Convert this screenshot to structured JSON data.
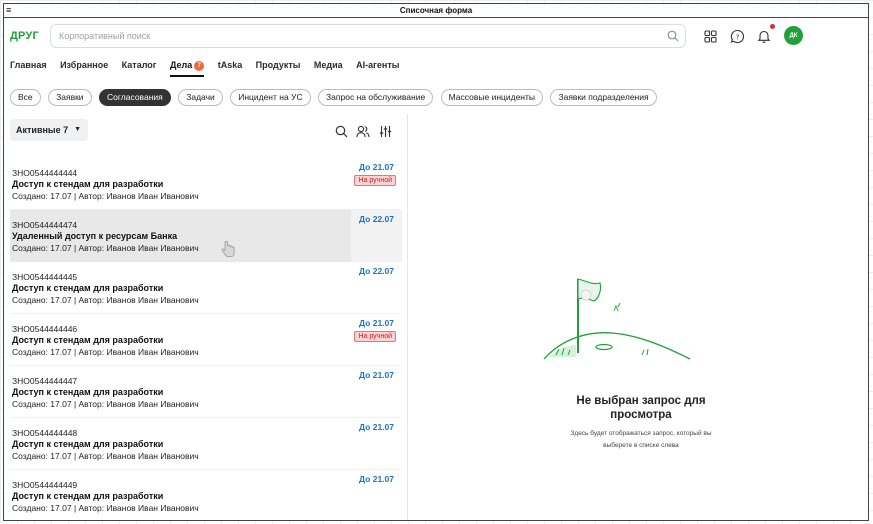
{
  "window": {
    "title": "Списочная форма",
    "menu_glyph": "≡"
  },
  "header": {
    "logo": "ДРУГ",
    "search_placeholder": "Корпоративный поиск",
    "avatar_initials": "ДК",
    "icons": [
      "grid-icon",
      "chat-help-icon",
      "bell-icon"
    ]
  },
  "nav": {
    "items": [
      {
        "label": "Главная"
      },
      {
        "label": "Избранное"
      },
      {
        "label": "Каталог"
      },
      {
        "label": "Дела",
        "badge": "7",
        "active": true
      },
      {
        "label": "tAska"
      },
      {
        "label": "Продукты"
      },
      {
        "label": "Медиа"
      },
      {
        "label": "AI-агенты"
      }
    ]
  },
  "chips": [
    "Все",
    "Заявки",
    "Согласования",
    "Задачи",
    "Инцидент на УС",
    "Запрос на обслуживание",
    "Массовые инциденты",
    "Заявки подразделения"
  ],
  "active_chip": "Согласования",
  "filter": {
    "label": "Активные 7"
  },
  "list": [
    {
      "number": "ЗНО0544444444",
      "title": "Доступ к стендам для разработки",
      "meta": "Создано: 17.07 | Автор: Иванов Иван Иванович",
      "due": "До 21.07",
      "status": "На ручной"
    },
    {
      "number": "ЗНО0544444474",
      "title": "Удаленный доступ к ресурсам Банка",
      "meta": "Создано: 17.07 | Автор: Иванов Иван Иванович",
      "due": "До 22.07",
      "status": ""
    },
    {
      "number": "ЗНО0544444445",
      "title": "Доступ к стендам для разработки",
      "meta": "Создано: 17.07 | Автор: Иванов Иван Иванович",
      "due": "До 22.07",
      "status": ""
    },
    {
      "number": "ЗНО0544444446",
      "title": "Доступ к стендам для разработки",
      "meta": "Создано: 17.07 | Автор: Иванов Иван Иванович",
      "due": "До 21.07",
      "status": "На ручной"
    },
    {
      "number": "ЗНО0544444447",
      "title": "Доступ к стендам для разработки",
      "meta": "Создано: 17.07 | Автор: Иванов Иван Иванович",
      "due": "До 21.07",
      "status": ""
    },
    {
      "number": "ЗНО0544444448",
      "title": "Доступ к стендам для разработки",
      "meta": "Создано: 17.07 | Автор: Иванов Иван Иванович",
      "due": "До 21.07",
      "status": ""
    },
    {
      "number": "ЗНО0544444449",
      "title": "Доступ к стендам для разработки",
      "meta": "Создано: 17.07 | Автор: Иванов Иван Иванович",
      "due": "До 21.07",
      "status": ""
    }
  ],
  "empty_state": {
    "heading_line1": "Не выбран запрос для",
    "heading_line2": "просмотра",
    "sub_line1": "Здесь будет отображаться запрос, который вы",
    "sub_line2": "выберете в списке слева"
  },
  "colors": {
    "brand": "#21a038",
    "due": "#1a73c9",
    "status_bg": "#ffd3d3",
    "status_text": "#c02222",
    "badge": "#f2683a"
  }
}
